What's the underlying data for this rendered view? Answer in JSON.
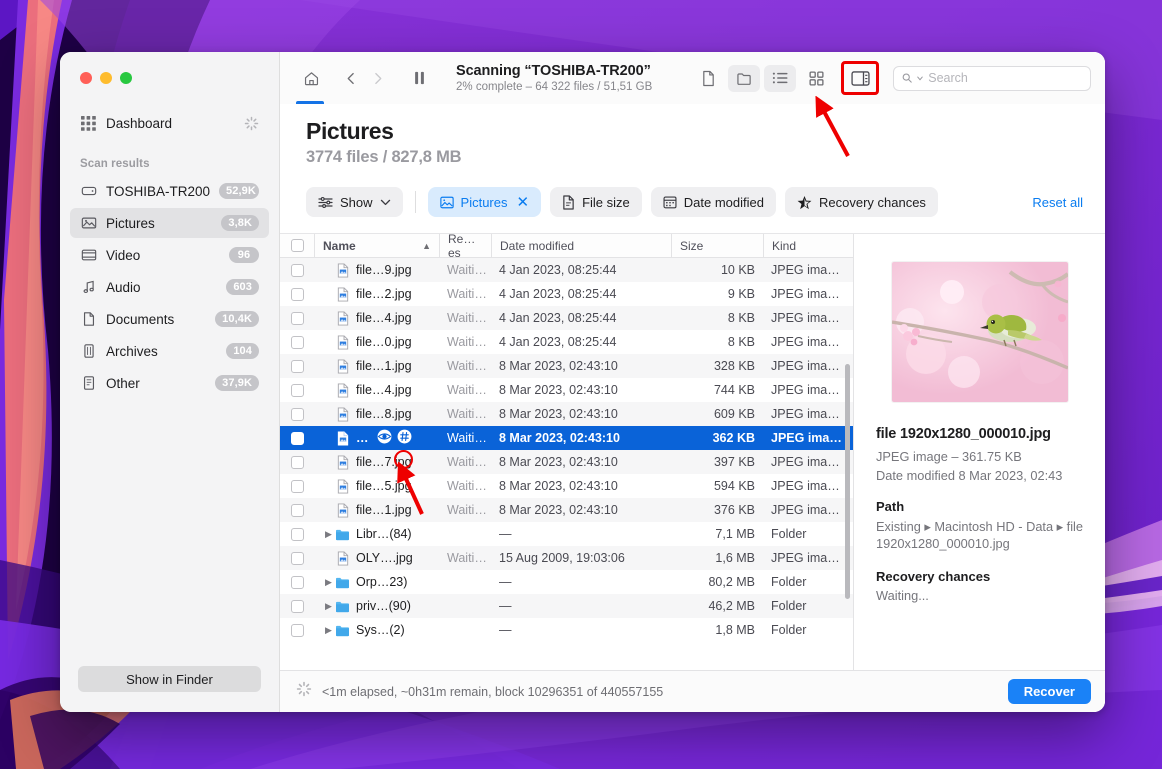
{
  "window": {
    "traffic_lights": [
      "close",
      "minimize",
      "zoom"
    ]
  },
  "sidebar": {
    "dashboard_label": "Dashboard",
    "section_title": "Scan results",
    "items": [
      {
        "label": "TOSHIBA-TR200",
        "badge": "52,9K",
        "icon": "disk-icon",
        "selected": false
      },
      {
        "label": "Pictures",
        "badge": "3,8K",
        "icon": "picture-icon",
        "selected": true
      },
      {
        "label": "Video",
        "badge": "96",
        "icon": "video-icon",
        "selected": false
      },
      {
        "label": "Audio",
        "badge": "603",
        "icon": "audio-icon",
        "selected": false
      },
      {
        "label": "Documents",
        "badge": "10,4K",
        "icon": "document-icon",
        "selected": false
      },
      {
        "label": "Archives",
        "badge": "104",
        "icon": "archive-icon",
        "selected": false
      },
      {
        "label": "Other",
        "badge": "37,9K",
        "icon": "other-icon",
        "selected": false
      }
    ],
    "show_in_finder_label": "Show in Finder"
  },
  "toolbar": {
    "scan_title": "Scanning “TOSHIBA-TR200”",
    "scan_subtitle": "2% complete – 64 322 files / 51,51 GB",
    "icons": [
      "home-icon",
      "back-icon",
      "forward-icon",
      "pause-icon"
    ],
    "view_buttons": [
      {
        "name": "file-view-icon",
        "active": false
      },
      {
        "name": "folder-view-icon",
        "active": true
      },
      {
        "name": "list-view-icon",
        "active": true
      },
      {
        "name": "grid-view-icon",
        "active": false
      }
    ],
    "panel_toggle_name": "side-panel-toggle-icon",
    "search_placeholder": "Search",
    "search_value": ""
  },
  "header": {
    "title": "Pictures",
    "subtitle": "3774 files / 827,8 MB"
  },
  "filters": {
    "show_label": "Show",
    "chips": [
      {
        "label": "Pictures",
        "icon": "picture-icon",
        "active": true,
        "dismissible": true
      },
      {
        "label": "File size",
        "icon": "document-icon",
        "active": false,
        "dismissible": false
      },
      {
        "label": "Date modified",
        "icon": "calendar-icon",
        "active": false,
        "dismissible": false
      },
      {
        "label": "Recovery chances",
        "icon": "star-icon",
        "active": false,
        "dismissible": false
      }
    ],
    "reset_label": "Reset all"
  },
  "table": {
    "columns": [
      "Name",
      "Re…es",
      "Date modified",
      "Size",
      "Kind"
    ],
    "sort_column": "Name",
    "sort_direction": "asc",
    "rows": [
      {
        "name": "file…9.jpg",
        "rec": "Waiti…",
        "date": "4 Jan 2023, 08:25:44",
        "size": "10 KB",
        "kind": "JPEG ima…",
        "type": "file",
        "selected": false
      },
      {
        "name": "file…2.jpg",
        "rec": "Waiti…",
        "date": "4 Jan 2023, 08:25:44",
        "size": "9 KB",
        "kind": "JPEG ima…",
        "type": "file",
        "selected": false
      },
      {
        "name": "file…4.jpg",
        "rec": "Waiti…",
        "date": "4 Jan 2023, 08:25:44",
        "size": "8 KB",
        "kind": "JPEG ima…",
        "type": "file",
        "selected": false
      },
      {
        "name": "file…0.jpg",
        "rec": "Waiti…",
        "date": "4 Jan 2023, 08:25:44",
        "size": "8 KB",
        "kind": "JPEG ima…",
        "type": "file",
        "selected": false
      },
      {
        "name": "file…1.jpg",
        "rec": "Waiti…",
        "date": "8 Mar 2023, 02:43:10",
        "size": "328 KB",
        "kind": "JPEG ima…",
        "type": "file",
        "selected": false
      },
      {
        "name": "file…4.jpg",
        "rec": "Waiti…",
        "date": "8 Mar 2023, 02:43:10",
        "size": "744 KB",
        "kind": "JPEG ima…",
        "type": "file",
        "selected": false
      },
      {
        "name": "file…8.jpg",
        "rec": "Waiti…",
        "date": "8 Mar 2023, 02:43:10",
        "size": "609 KB",
        "kind": "JPEG ima…",
        "type": "file",
        "selected": false
      },
      {
        "name": "…",
        "rec": "Waiti…",
        "date": "8 Mar 2023, 02:43:10",
        "size": "362 KB",
        "kind": "JPEG ima…",
        "type": "file",
        "selected": true,
        "row_actions": [
          "preview-eye-icon",
          "hash-icon"
        ]
      },
      {
        "name": "file…7.jpg",
        "rec": "Waiti…",
        "date": "8 Mar 2023, 02:43:10",
        "size": "397 KB",
        "kind": "JPEG ima…",
        "type": "file",
        "selected": false
      },
      {
        "name": "file…5.jpg",
        "rec": "Waiti…",
        "date": "8 Mar 2023, 02:43:10",
        "size": "594 KB",
        "kind": "JPEG ima…",
        "type": "file",
        "selected": false
      },
      {
        "name": "file…1.jpg",
        "rec": "Waiti…",
        "date": "8 Mar 2023, 02:43:10",
        "size": "376 KB",
        "kind": "JPEG ima…",
        "type": "file",
        "selected": false
      },
      {
        "name": "Libr…(84)",
        "rec": "",
        "date": "—",
        "size": "7,1 MB",
        "kind": "Folder",
        "type": "folder",
        "selected": false
      },
      {
        "name": "OLY….jpg",
        "rec": "Waiti…",
        "date": "15 Aug 2009, 19:03:06",
        "size": "1,6 MB",
        "kind": "JPEG ima…",
        "type": "file",
        "selected": false
      },
      {
        "name": "Orp…23)",
        "rec": "",
        "date": "—",
        "size": "80,2 MB",
        "kind": "Folder",
        "type": "folder",
        "selected": false
      },
      {
        "name": "priv…(90)",
        "rec": "",
        "date": "—",
        "size": "46,2 MB",
        "kind": "Folder",
        "type": "folder",
        "selected": false
      },
      {
        "name": "Sys…(2)",
        "rec": "",
        "date": "—",
        "size": "1,8 MB",
        "kind": "Folder",
        "type": "folder",
        "selected": false
      }
    ]
  },
  "preview": {
    "thumbnail_alt": "bird on cherry blossom branch",
    "file_name": "file 1920x1280_000010.jpg",
    "file_type_size": "JPEG image – 361.75 KB",
    "date_modified": "Date modified  8 Mar 2023, 02:43",
    "path_heading": "Path",
    "path_value": "Existing ▸ Macintosh HD - Data ▸ file 1920x1280_000010.jpg",
    "recovery_heading": "Recovery chances",
    "recovery_value": "Waiting..."
  },
  "statusbar": {
    "status_text": "<1m elapsed, ~0h31m remain, block 10296351 of 440557155",
    "recover_label": "Recover"
  },
  "colors": {
    "accent_blue": "#1a82f7",
    "selection_blue": "#0a63d8",
    "link_blue": "#0a7cf0",
    "annotation_red": "#ee0000",
    "traffic_red": "#ff5f57",
    "traffic_yellow": "#febc2e",
    "traffic_green": "#28c840"
  }
}
